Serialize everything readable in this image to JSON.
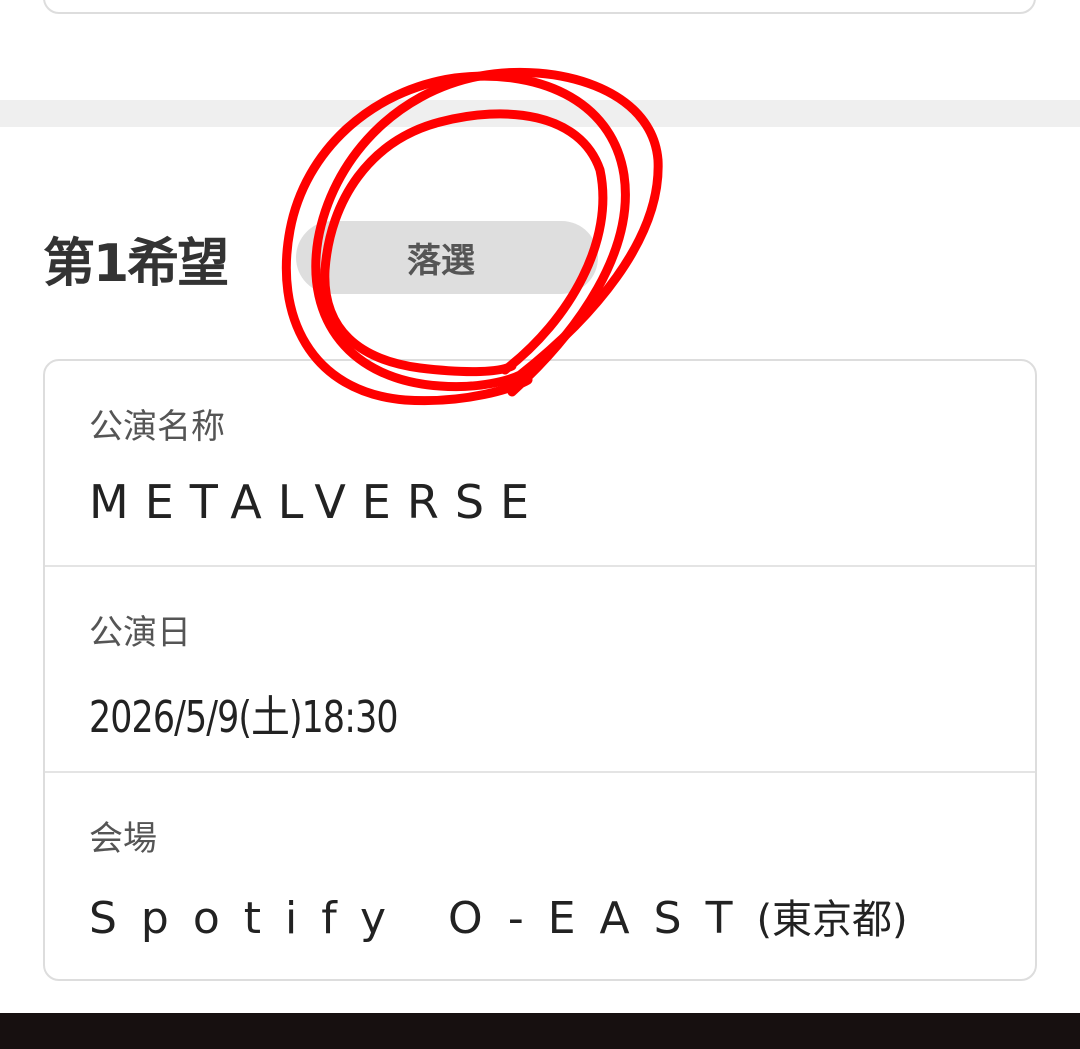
{
  "choice": {
    "title": "第1希望",
    "status": "落選"
  },
  "details": {
    "name_label": "公演名称",
    "name_value": "METALVERSE",
    "date_label": "公演日",
    "date_value": "2026/5/9(土)18:30",
    "venue_label": "会場",
    "venue_value": "Spotify O-EAST",
    "venue_pref": "(東京都)"
  },
  "annotation": {
    "color": "#ff0000",
    "shape": "hand-drawn-circle-around-status"
  }
}
